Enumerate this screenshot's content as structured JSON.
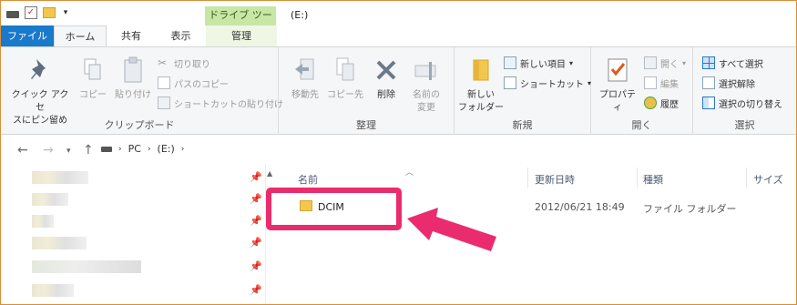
{
  "window": {
    "title": "(E:)"
  },
  "context_tab": {
    "title": "ドライブ ツール"
  },
  "tabs": {
    "file": "ファイル",
    "home": "ホーム",
    "share": "共有",
    "view": "表示",
    "manage": "管理"
  },
  "ribbon": {
    "clipboard": {
      "label": "クリップボード",
      "pin_quick": "クイック アクセ\nスにピン留め",
      "copy": "コピー",
      "paste": "貼り付け",
      "cut": "切り取り",
      "copy_path": "パスのコピー",
      "paste_shortcut": "ショートカットの貼り付け"
    },
    "organize": {
      "label": "整理",
      "move_to": "移動先",
      "copy_to": "コピー先",
      "delete": "削除",
      "rename": "名前の\n変更"
    },
    "new": {
      "label": "新規",
      "new_folder": "新しい\nフォルダー",
      "new_item": "新しい項目",
      "shortcut": "ショートカット"
    },
    "open": {
      "label": "開く",
      "properties": "プロパティ",
      "open": "開く",
      "edit": "編集",
      "history": "履歴"
    },
    "select": {
      "label": "選択",
      "select_all": "すべて選択",
      "select_none": "選択解除",
      "invert": "選択の切り替え"
    }
  },
  "address": {
    "crumbs": [
      "PC",
      "(E:)"
    ]
  },
  "columns": {
    "name": "名前",
    "date": "更新日時",
    "type": "種類",
    "size": "サイズ"
  },
  "files": [
    {
      "name": "DCIM",
      "date": "2012/06/21 18:49",
      "type": "ファイル フォルダー"
    }
  ],
  "colors": {
    "accent": "#1979ca",
    "highlight": "#ea2c6e",
    "context_tab": "#c8e6a6"
  }
}
